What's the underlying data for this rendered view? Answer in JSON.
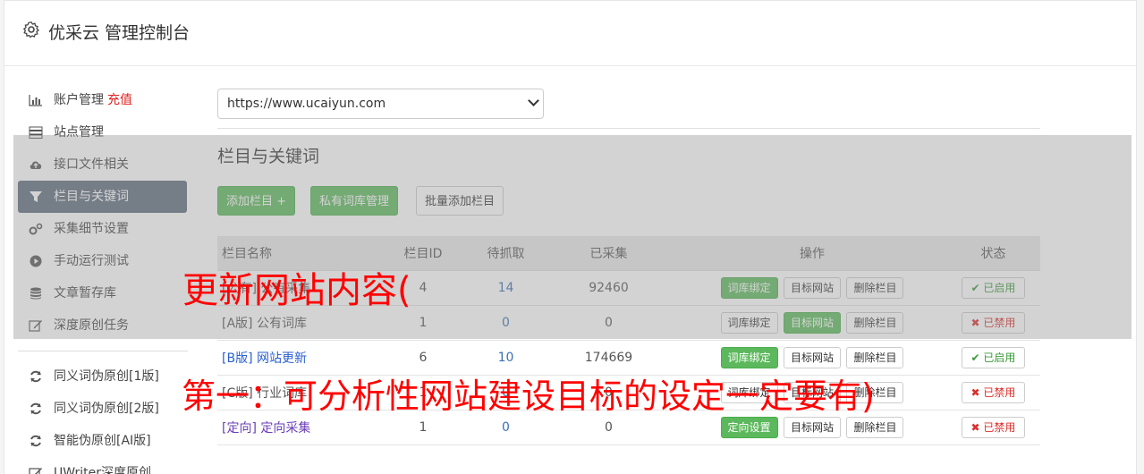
{
  "header": {
    "title": "优采云 管理控制台",
    "icon": "gear-icon"
  },
  "sidebar": {
    "items": [
      {
        "label": "账户管理",
        "extra": "充值",
        "icon": "bar-chart-icon"
      },
      {
        "label": "站点管理",
        "icon": "server-icon"
      },
      {
        "label": "接口文件相关",
        "icon": "cloud-upload-icon"
      },
      {
        "label": "栏目与关键词",
        "icon": "filter-icon",
        "active": true
      },
      {
        "label": "采集细节设置",
        "icon": "gears-icon"
      },
      {
        "label": "手动运行测试",
        "icon": "play-circle-icon"
      },
      {
        "label": "文章暂存库",
        "icon": "database-icon"
      },
      {
        "label": "深度原创任务",
        "icon": "edit-icon"
      }
    ],
    "items2": [
      {
        "label": "同义词伪原创[1版]",
        "icon": "refresh-icon"
      },
      {
        "label": "同义词伪原创[2版]",
        "icon": "refresh-icon"
      },
      {
        "label": "智能伪原创[AI版]",
        "icon": "refresh-icon"
      },
      {
        "label": "UWriter深度原创",
        "icon": "edit-icon"
      }
    ]
  },
  "site_select": {
    "value": "https://www.ucaiyun.com"
  },
  "section": {
    "title": "栏目与关键词"
  },
  "toolbar": {
    "add_label": "添加栏目 +",
    "private_label": "私有词库管理",
    "batch_label": "批量添加栏目"
  },
  "table": {
    "headers": [
      "栏目名称",
      "栏目ID",
      "待抓取",
      "已采集",
      "操作",
      "状态"
    ],
    "rows": [
      {
        "name": "[公有] 公有采集",
        "id": "4",
        "pending": "14",
        "collected": "92460",
        "btn1": "词库绑定",
        "btn2": "目标网站",
        "btn3": "删除栏目",
        "status": "已启用"
      },
      {
        "name": "[A版] 公有词库",
        "id": "1",
        "pending": "0",
        "collected": "0",
        "btn1": "词库绑定",
        "btn2": "目标网站",
        "btn3": "删除栏目",
        "status": "已禁用"
      },
      {
        "name": "[B版] 网站更新",
        "id": "6",
        "pending": "10",
        "collected": "174669",
        "btn1": "词库绑定",
        "btn2": "目标网站",
        "btn3": "删除栏目",
        "status": "已启用"
      },
      {
        "name": "[C版] 行业词库",
        "id": "1",
        "pending": "0",
        "collected": "0",
        "btn1": "词库绑定",
        "btn2": "目标网站",
        "btn3": "删除栏目",
        "status": "已禁用"
      },
      {
        "name": "[定向] 定向采集",
        "id": "1",
        "pending": "0",
        "collected": "0",
        "btn1": "定向设置",
        "btn2": "目标网站",
        "btn3": "删除栏目",
        "status": "已禁用"
      }
    ]
  },
  "overlay_text": {
    "line1": "更新网站内容(",
    "line2": "第一：可分析性网站建设目标的设定一定要有)"
  }
}
